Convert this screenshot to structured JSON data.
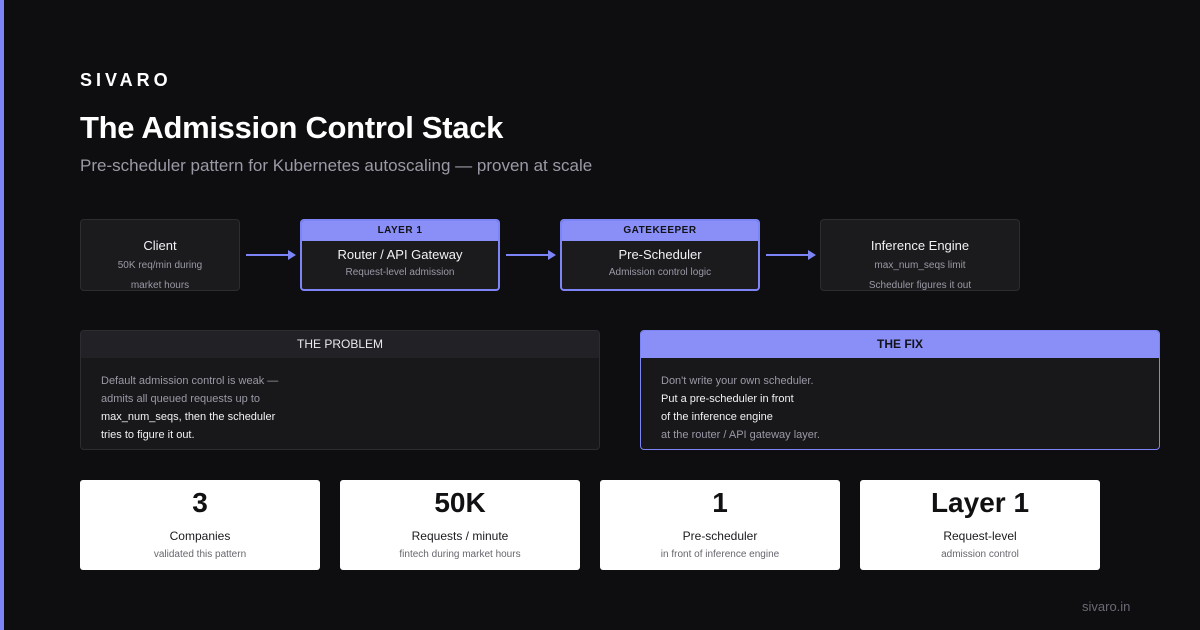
{
  "brand": "SIVARO",
  "title": "The Admission Control Stack",
  "subtitle": "Pre-scheduler pattern for Kubernetes autoscaling — proven at scale",
  "flow": {
    "client": {
      "name": "Client",
      "desc": [
        "50K req/min during",
        "market hours"
      ]
    },
    "router": {
      "tag": "LAYER 1",
      "name": "Router / API Gateway",
      "desc": "Request-level admission"
    },
    "prescheduler": {
      "tag": "GATEKEEPER",
      "name": "Pre-Scheduler",
      "desc": "Admission control logic"
    },
    "engine": {
      "name": "Inference Engine",
      "desc": [
        "max_num_seqs limit",
        "Scheduler figures it out"
      ]
    }
  },
  "problem": {
    "heading": "THE PROBLEM",
    "lines": [
      "Default admission control is weak —",
      "admits all queued requests up to",
      "max_num_seqs, then the scheduler",
      "tries to figure it out."
    ]
  },
  "fix": {
    "heading": "THE FIX",
    "lines": [
      "Don't write your own scheduler.",
      "Put a pre-scheduler in front",
      "of the inference engine",
      "at the router / API gateway layer."
    ]
  },
  "stats": [
    {
      "value": "3",
      "label": "Companies",
      "sub": "validated this pattern"
    },
    {
      "value": "50K",
      "label": "Requests / minute",
      "sub": "fintech during market hours"
    },
    {
      "value": "1",
      "label": "Pre-scheduler",
      "sub": "in front of inference engine"
    },
    {
      "value": "Layer 1",
      "label": "Request-level",
      "sub": "admission control"
    }
  ],
  "footer": "sivaro.in",
  "colors": {
    "accent": "#7c84f6",
    "background": "#0e0e10",
    "card": "#ffffff"
  }
}
